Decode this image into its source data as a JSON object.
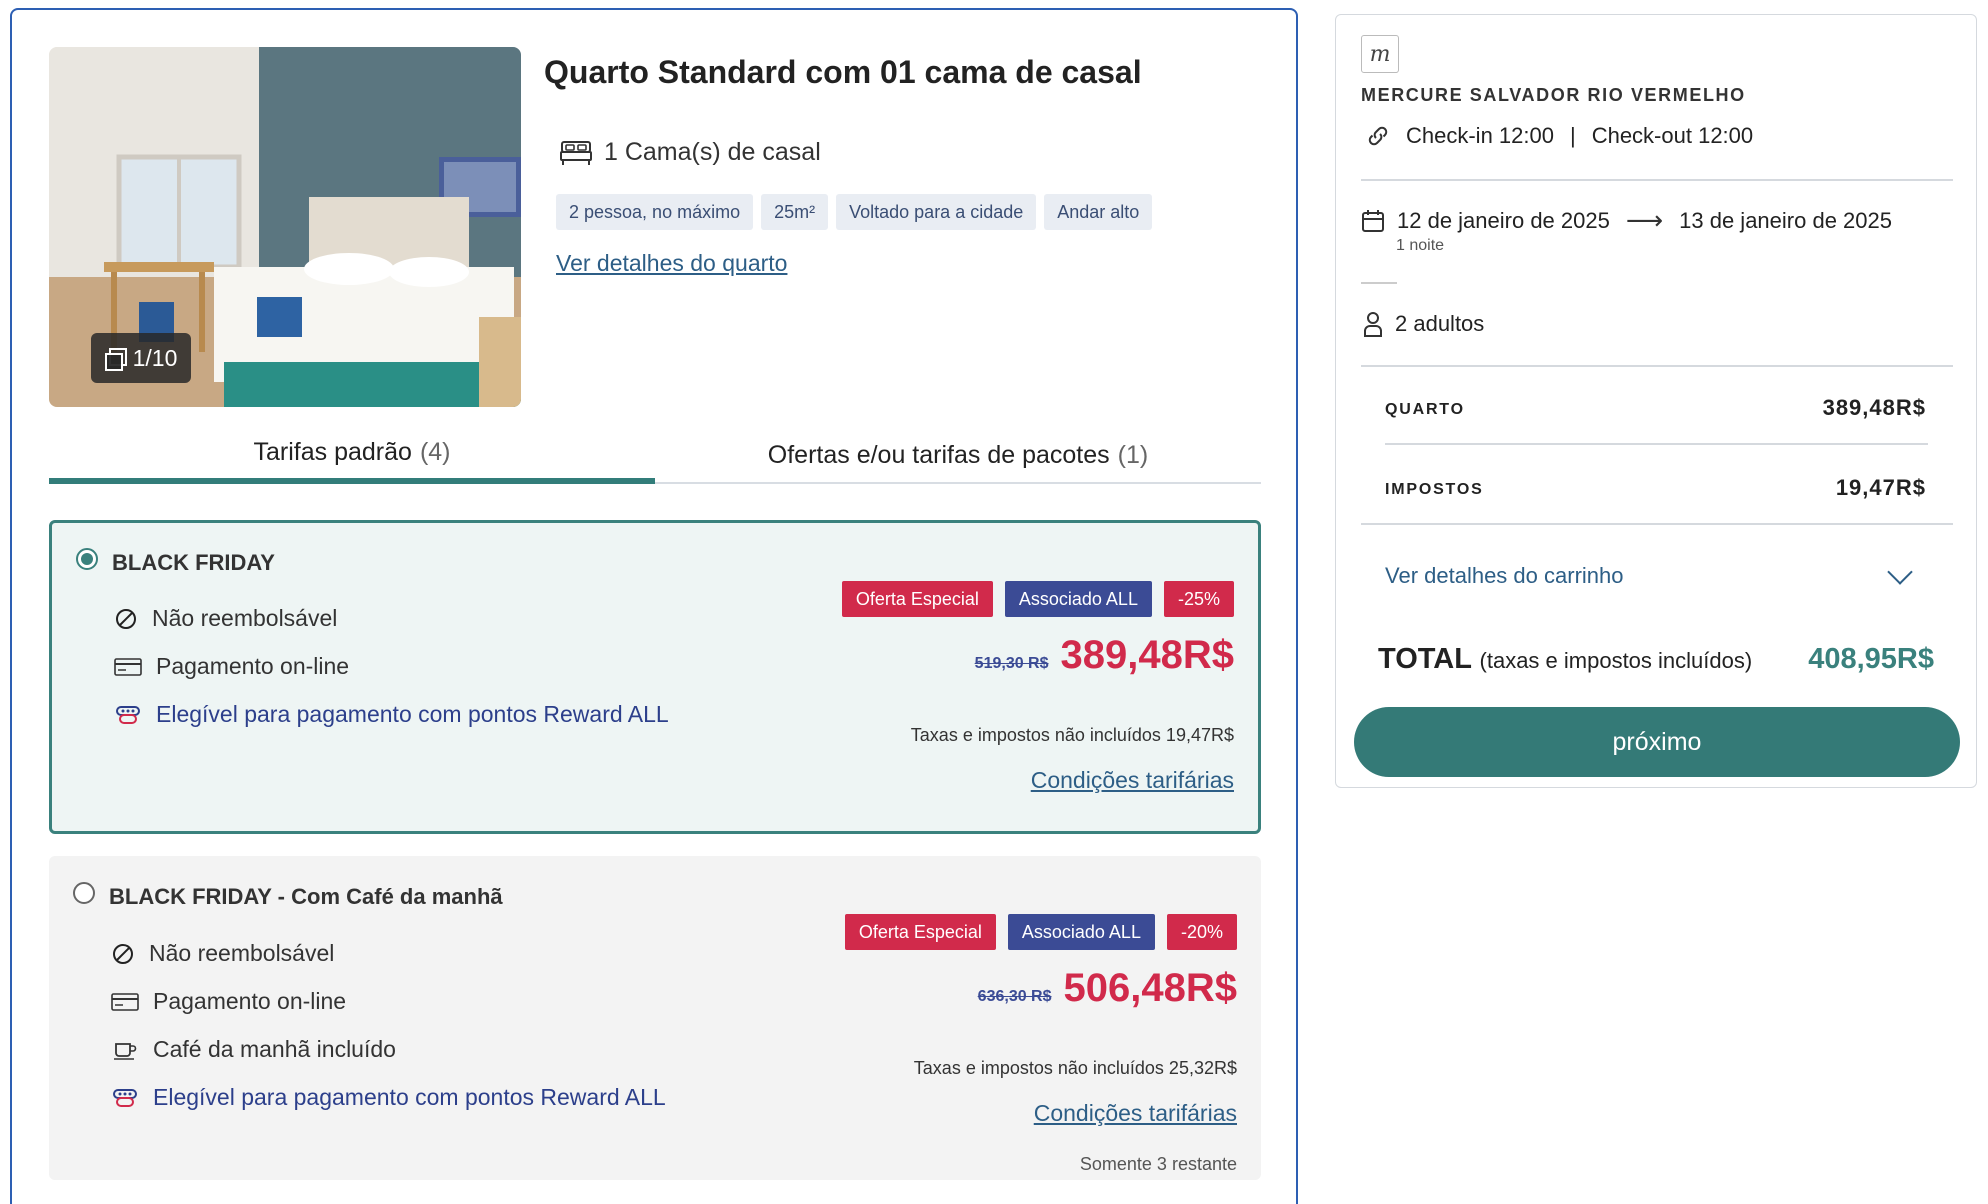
{
  "room": {
    "title": "Quarto Standard com 01 cama de casal",
    "bed": "1 Cama(s) de casal",
    "photo_counter": "1/10",
    "tags": [
      "2 pessoa, no máximo",
      "25m²",
      "Voltado para a cidade",
      "Andar alto"
    ],
    "details_link": "Ver detalhes do quarto"
  },
  "tabs": [
    {
      "label": "Tarifas padrão",
      "count": "(4)",
      "active": true
    },
    {
      "label": "Ofertas e/ou tarifas de pacotes",
      "count": "(1)",
      "active": false
    }
  ],
  "rates": [
    {
      "name": "BLACK FRIDAY",
      "selected": true,
      "features": [
        "Não reembolsável",
        "Pagamento on-line",
        "Elegível para pagamento com pontos Reward ALL"
      ],
      "badges": [
        "Oferta Especial",
        "Associado ALL",
        "-25%"
      ],
      "old_price": "519,30 R$",
      "price": "389,48R$",
      "tax_note": "Taxas e impostos não incluídos 19,47R$",
      "conditions": "Condições tarifárias"
    },
    {
      "name": "BLACK FRIDAY - Com Café da manhã",
      "selected": false,
      "features": [
        "Não reembolsável",
        "Pagamento on-line",
        "Café da manhã incluído",
        "Elegível para pagamento com pontos Reward ALL"
      ],
      "badges": [
        "Oferta Especial",
        "Associado ALL",
        "-20%"
      ],
      "old_price": "636,30 R$",
      "price": "506,48R$",
      "tax_note": "Taxas e impostos não incluídos 25,32R$",
      "conditions": "Condições tarifárias",
      "remaining": "Somente 3 restante"
    }
  ],
  "summary": {
    "hotel_name": "MERCURE SALVADOR RIO VERMELHO",
    "checkin": "Check-in 12:00",
    "separator": "|",
    "checkout": "Check-out 12:00",
    "date_from": "12 de janeiro de 2025",
    "date_to": "13 de janeiro de 2025",
    "nights": "1 noite",
    "guests": "2 adultos",
    "room_label": "QUARTO",
    "room_value": "389,48R$",
    "tax_label": "IMPOSTOS",
    "tax_value": "19,47R$",
    "cart_link": "Ver detalhes do carrinho",
    "total_label": "TOTAL",
    "total_sub": "(taxas e impostos incluídos)",
    "total_value": "408,95R$",
    "next_button": "próximo"
  },
  "colors": {
    "accent_teal": "#3a817d",
    "price_red": "#d12a4b",
    "badge_blue": "#3b4b95",
    "border_blue": "#2d5fb3"
  }
}
